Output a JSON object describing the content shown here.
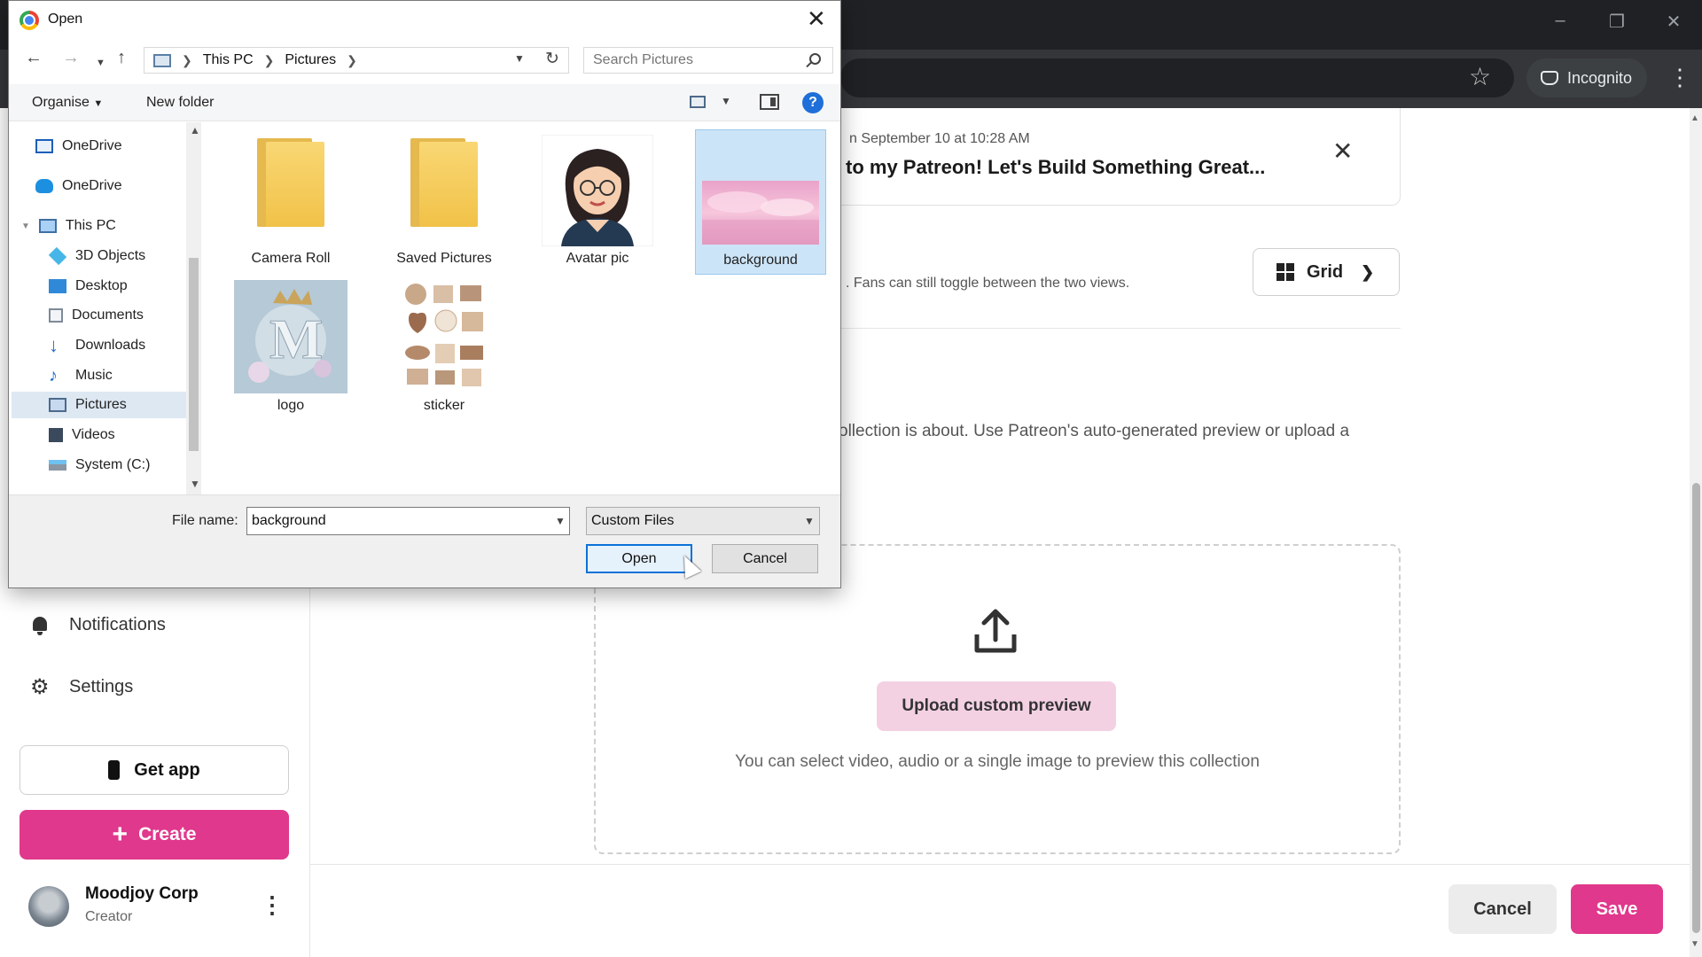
{
  "browser": {
    "incognito_label": "Incognito"
  },
  "sidebar": {
    "notifications": "Notifications",
    "settings": "Settings",
    "get_app": "Get app",
    "create": "Create",
    "profile": {
      "name": "Moodjoy Corp",
      "role": "Creator"
    }
  },
  "main": {
    "post_card": {
      "date": "n September 10 at 10:28 AM",
      "title": "to my Patreon! Let's Build Something Great..."
    },
    "view_text": ". Fans can still toggle between the two views.",
    "view_select": "Grid",
    "preview_description": "ollection is about. Use Patreon's auto-generated preview or upload a",
    "upload_button": "Upload custom preview",
    "upload_help": "You can select video, audio or a single image to preview this collection",
    "cancel": "Cancel",
    "save": "Save"
  },
  "dialog": {
    "title": "Open",
    "breadcrumb": [
      "This PC",
      "Pictures"
    ],
    "search_placeholder": "Search Pictures",
    "organise": "Organise",
    "new_folder": "New folder",
    "help_glyph": "?",
    "nav_items": [
      {
        "label": "OneDrive",
        "icon": "onedrive-business-icon"
      },
      {
        "label": "OneDrive",
        "icon": "onedrive-cloud-icon"
      },
      {
        "label": "This PC",
        "icon": "computer-icon"
      },
      {
        "label": "3D Objects",
        "icon": "cube-icon"
      },
      {
        "label": "Desktop",
        "icon": "desktop-icon"
      },
      {
        "label": "Documents",
        "icon": "document-icon"
      },
      {
        "label": "Downloads",
        "icon": "download-arrow-icon"
      },
      {
        "label": "Music",
        "icon": "music-note-icon"
      },
      {
        "label": "Pictures",
        "icon": "pictures-icon"
      },
      {
        "label": "Videos",
        "icon": "film-icon"
      },
      {
        "label": "System (C:)",
        "icon": "drive-icon"
      }
    ],
    "files": [
      {
        "label": "Camera Roll",
        "kind": "folder"
      },
      {
        "label": "Saved Pictures",
        "kind": "folder"
      },
      {
        "label": "Avatar pic",
        "kind": "image"
      },
      {
        "label": "background",
        "kind": "image"
      },
      {
        "label": "logo",
        "kind": "image"
      },
      {
        "label": "sticker",
        "kind": "image"
      }
    ],
    "file_name_label": "File name:",
    "file_name_value": "background",
    "file_type": "Custom Files",
    "open_button": "Open",
    "cancel_button": "Cancel"
  },
  "colors": {
    "accent": "#e0388c",
    "accent_light": "#f3d1e3",
    "selection": "#cce4f7",
    "dialog_primary_border": "#0a72d8"
  }
}
